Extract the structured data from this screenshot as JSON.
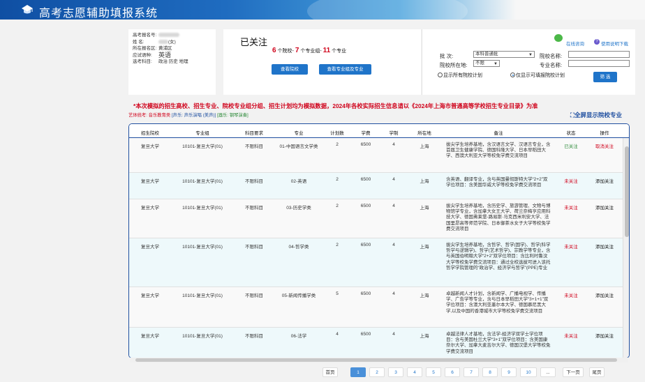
{
  "header": {
    "title": "高考志愿辅助填报系统",
    "logo_icon": "graduation-cap-icon",
    "colors": {
      "start": "#0f4fa3",
      "mid": "#4aa3dd",
      "end": "#f7f7f7"
    }
  },
  "profile": {
    "rows": [
      {
        "key": "高考报名号:",
        "value": ""
      },
      {
        "key": "姓    名:",
        "value": "(女)"
      },
      {
        "key": "所在报名区:",
        "value": "黄浦区"
      },
      {
        "key": "应试语种:",
        "value": "英语"
      },
      {
        "key": "选考科目:",
        "value": "政治  历史  地理"
      }
    ]
  },
  "favorites": {
    "title": "已关注",
    "schools_count": "6",
    "schools_label": "个院校-",
    "groups_count": "7",
    "groups_label": "个专业组-",
    "majors_count": "11",
    "majors_label": "个专业",
    "view_schools_button": "查看院校",
    "view_groups_button": "查看专业组及专业"
  },
  "filter": {
    "online_consult": "在线咨询",
    "manual_download": "使用说明下载",
    "batch_label": "批  次:",
    "batch_value": "本科普通批",
    "region_label": "院校所在地:",
    "region_value": "不限",
    "school_name_label": "院校名称:",
    "major_name_label": "专业名称:",
    "radio_all": "显示所有院校计划",
    "radio_fillable": "仅显示可填报院校计划",
    "filter_button": "筛 选"
  },
  "notice": "*本次模拟的招生高校、招生专业、院校专业组分组、招生计划均为模拟数据，2024年各校实际招生信息请以《2024年上海市普通高等学校招生专业目录》为准",
  "arts": {
    "prefix": "艺体统考: 音乐教育类",
    "sound": "[声乐: 声乐演唱 (美声)]",
    "instrument": "[器乐: 钢琴演奏]"
  },
  "fullscreen_label": "全屏显示院校专业",
  "table": {
    "headers": [
      "招生院校",
      "专业组",
      "科目要求",
      "专业",
      "计划数",
      "学费",
      "学制",
      "所在地",
      "备注",
      "状态",
      "操作"
    ],
    "rows": [
      {
        "school": "复旦大学",
        "group": "10101-复旦大学(01)",
        "subject": "不限科目",
        "major": "01-中国语言文学类",
        "plan": "2",
        "fee": "6500",
        "years": "4",
        "location": "上海",
        "note": "拔尖学生培养基地，含汉语言文学、汉语言专业，含首届卫生健康学院、德国科隆大学、日本早稻田大学、西澳大利亚大学等校免学费交流项目",
        "status": "已关注",
        "action": "取消关注"
      },
      {
        "school": "复旦大学",
        "group": "10101-复旦大学(01)",
        "subject": "不限科目",
        "major": "02-英语",
        "plan": "2",
        "fee": "6500",
        "years": "4",
        "location": "上海",
        "note": "含英语、翻译专业，含与英国曼彻斯特大学“2+2”双学位项目：含美国华威大学等校免学费交流项目",
        "status": "未关注",
        "action": "添加关注"
      },
      {
        "school": "复旦大学",
        "group": "10101-复旦大学(01)",
        "subject": "不限科目",
        "major": "03-历史学类",
        "plan": "2",
        "fee": "6500",
        "years": "4",
        "location": "上海",
        "note": "拔尖学生培养基地，含历史学、旅游管理、文物与博物馆学专业，含加拿大女王大学、荷兰奈梅亨应用科技大学、德国弗莱堡-路易斯·马克西米利安大学、法国里昂高等师范学院、日本御茶水女子大学等校免学费交流项目",
        "status": "未关注",
        "action": "添加关注"
      },
      {
        "school": "复旦大学",
        "group": "10101-复旦大学(01)",
        "subject": "不限科目",
        "major": "04-哲学类",
        "plan": "2",
        "fee": "6500",
        "years": "4",
        "location": "上海",
        "note": "拔尖学生培养基地，含哲学、哲学(国学)、哲学(科学哲学与逻辑学)、哲学(艺术哲学)、宗教学等专业，含与英国伯明翰大学“2+2”双学位项目：含比利时鲁汶大学等校免学费交流项目：通过全校选拔可进入该托哲学学院管理的“政治学、经济学与哲学”(PPE)专业",
        "status": "未关注",
        "action": "添加关注"
      },
      {
        "school": "复旦大学",
        "group": "10101-复旦大学(01)",
        "subject": "不限科目",
        "major": "05-新闻传播学类",
        "plan": "5",
        "fee": "6500",
        "years": "4",
        "location": "上海",
        "note": "卓越新闻人才计划，含新闻学、广播电视学、传播学、广告学等专业，含与日本早稻田大学“3+1+1”双学位项目：含澳大利亚墨尔本大学、德国慕尼黑大学,以及中国的香港城市大学等校免学费交流项目",
        "status": "未关注",
        "action": "添加关注"
      },
      {
        "school": "复旦大学",
        "group": "10101-复旦大学(01)",
        "subject": "不限科目",
        "major": "06-法学",
        "plan": "4",
        "fee": "6500",
        "years": "4",
        "location": "上海",
        "note": "卓越法律人才基地，含法学-经济学双学士学位项目：含与美国杜兰大学“3+1”双学位项目：含美国康奈尔大学、加拿大麦吉尔大学、德国汉堡大学等校免学费交流项目",
        "status": "未关注",
        "action": "添加关注"
      },
      {
        "school": "复旦大学",
        "group": "10101-复旦大学(01)",
        "subject": "不限科目",
        "major": "07-社会科学试验班",
        "plan": "6",
        "fee": "6500",
        "years": "4",
        "location": "上海",
        "note": "含社会学、社会工作、国际政治、政治学与行政学",
        "status": "未关注",
        "action": "添加关注"
      }
    ]
  },
  "pagination": {
    "first": "首页",
    "pages": [
      "1",
      "2",
      "3",
      "4",
      "5",
      "6",
      "7",
      "8",
      "9",
      "10"
    ],
    "current": "1",
    "ellipsis": "...",
    "next": "下一页",
    "last": "尾页"
  }
}
